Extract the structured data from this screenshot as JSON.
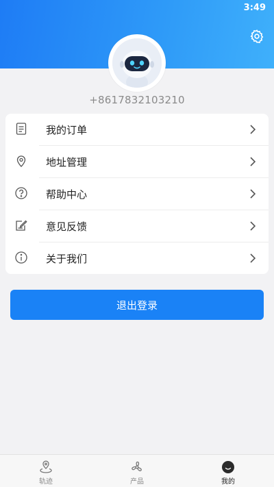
{
  "status_bar": {
    "time": "3:49"
  },
  "header": {
    "settings_icon": "gear-icon",
    "gradient": [
      "#1e7cf5",
      "#3fb0fb"
    ]
  },
  "profile": {
    "avatar_icon": "robot-avatar-icon",
    "phone": "+8617832103210"
  },
  "menu": {
    "items": [
      {
        "label": "我的订单",
        "icon": "document-icon"
      },
      {
        "label": "地址管理",
        "icon": "location-pin-icon"
      },
      {
        "label": "帮助中心",
        "icon": "question-circle-icon"
      },
      {
        "label": "意见反馈",
        "icon": "feedback-edit-icon"
      },
      {
        "label": "关于我们",
        "icon": "info-circle-icon"
      }
    ]
  },
  "logout_button": {
    "label": "退出登录",
    "color": "#1a82f6"
  },
  "tabbar": {
    "tabs": [
      {
        "label": "轨迹",
        "icon": "track-location-icon",
        "active": false
      },
      {
        "label": "产品",
        "icon": "product-fan-icon",
        "active": false
      },
      {
        "label": "我的",
        "icon": "profile-icon",
        "active": true
      }
    ]
  }
}
